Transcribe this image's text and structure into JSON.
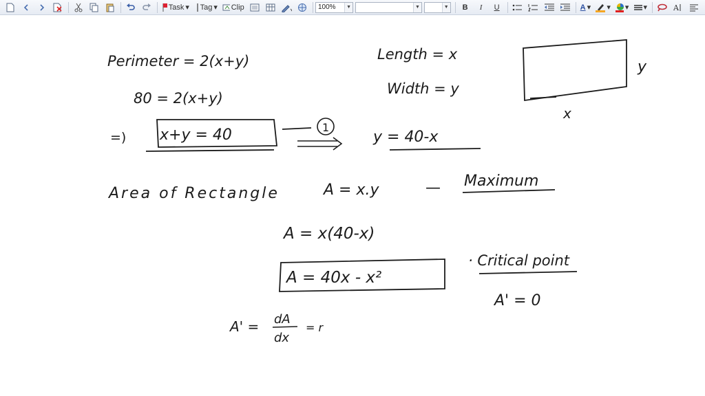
{
  "toolbar": {
    "task_label": "Task",
    "tag_label": "Tag",
    "clip_label": "Clip",
    "zoom_value": "100%",
    "font_name_value": "",
    "font_size_value": "",
    "bold": "B",
    "italic": "I",
    "underline": "U",
    "font_color": "A",
    "highlight_color": "#f5a623",
    "text_color": "#e02020"
  },
  "notes": {
    "perimeter_eq": "Perimeter = 2(x+y)",
    "length_eq": "Length = x",
    "width_eq": "Width = y",
    "rect_side_y": "y",
    "rect_side_x": "x",
    "eq_80": "80 = 2(x+y)",
    "implies": "=)",
    "boxed_sum": "x+y = 40",
    "eq_number": "1",
    "y_expr": "y = 40-x",
    "area_text": "Area of Rectangle",
    "area_eq": "A = x.y",
    "dash": "—",
    "maximum": "Maximum",
    "area_sub": "A = x(40-x)",
    "area_boxed": "A = 40x - x²",
    "critical_point": "· Critical point",
    "a_prime_zero": "A' = 0",
    "a_prime": "A' =",
    "dA": "dA",
    "dx": "dx",
    "trail": "= r"
  }
}
